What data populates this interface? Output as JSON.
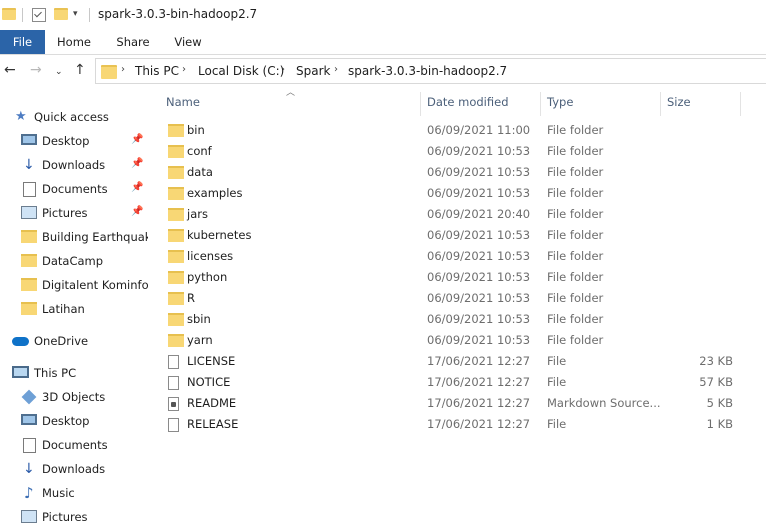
{
  "window": {
    "title": "spark-3.0.3-bin-hadoop2.7"
  },
  "ribbon": {
    "tabs": [
      "File",
      "Home",
      "Share",
      "View"
    ]
  },
  "address": {
    "breadcrumbs": [
      "This PC",
      "Local Disk (C:)",
      "Spark",
      "spark-3.0.3-bin-hadoop2.7"
    ]
  },
  "nav": {
    "quick_access": "Quick access",
    "quick_items": [
      {
        "label": "Desktop",
        "pinned": true
      },
      {
        "label": "Downloads",
        "pinned": true
      },
      {
        "label": "Documents",
        "pinned": true
      },
      {
        "label": "Pictures",
        "pinned": true
      },
      {
        "label": "Building Earthquake",
        "pinned": false
      },
      {
        "label": "DataCamp",
        "pinned": false
      },
      {
        "label": "Digitalent Kominfo",
        "pinned": false
      },
      {
        "label": "Latihan",
        "pinned": false
      }
    ],
    "onedrive": "OneDrive",
    "this_pc": "This PC",
    "pc_items": [
      "3D Objects",
      "Desktop",
      "Documents",
      "Downloads",
      "Music",
      "Pictures"
    ]
  },
  "columns": {
    "name": "Name",
    "date": "Date modified",
    "type": "Type",
    "size": "Size"
  },
  "files": [
    {
      "name": "bin",
      "date": "06/09/2021 11:00",
      "type": "File folder",
      "size": "",
      "icon": "folder-icon"
    },
    {
      "name": "conf",
      "date": "06/09/2021 10:53",
      "type": "File folder",
      "size": "",
      "icon": "folder-icon"
    },
    {
      "name": "data",
      "date": "06/09/2021 10:53",
      "type": "File folder",
      "size": "",
      "icon": "folder-icon"
    },
    {
      "name": "examples",
      "date": "06/09/2021 10:53",
      "type": "File folder",
      "size": "",
      "icon": "folder-icon"
    },
    {
      "name": "jars",
      "date": "06/09/2021 20:40",
      "type": "File folder",
      "size": "",
      "icon": "folder-icon"
    },
    {
      "name": "kubernetes",
      "date": "06/09/2021 10:53",
      "type": "File folder",
      "size": "",
      "icon": "folder-icon"
    },
    {
      "name": "licenses",
      "date": "06/09/2021 10:53",
      "type": "File folder",
      "size": "",
      "icon": "folder-icon"
    },
    {
      "name": "python",
      "date": "06/09/2021 10:53",
      "type": "File folder",
      "size": "",
      "icon": "folder-icon"
    },
    {
      "name": "R",
      "date": "06/09/2021 10:53",
      "type": "File folder",
      "size": "",
      "icon": "folder-icon"
    },
    {
      "name": "sbin",
      "date": "06/09/2021 10:53",
      "type": "File folder",
      "size": "",
      "icon": "folder-icon"
    },
    {
      "name": "yarn",
      "date": "06/09/2021 10:53",
      "type": "File folder",
      "size": "",
      "icon": "folder-icon"
    },
    {
      "name": "LICENSE",
      "date": "17/06/2021 12:27",
      "type": "File",
      "size": "23 KB",
      "icon": "file-icon"
    },
    {
      "name": "NOTICE",
      "date": "17/06/2021 12:27",
      "type": "File",
      "size": "57 KB",
      "icon": "file-icon"
    },
    {
      "name": "README",
      "date": "17/06/2021 12:27",
      "type": "Markdown Source...",
      "size": "5 KB",
      "icon": "markdown-file-icon"
    },
    {
      "name": "RELEASE",
      "date": "17/06/2021 12:27",
      "type": "File",
      "size": "1 KB",
      "icon": "file-icon"
    }
  ]
}
